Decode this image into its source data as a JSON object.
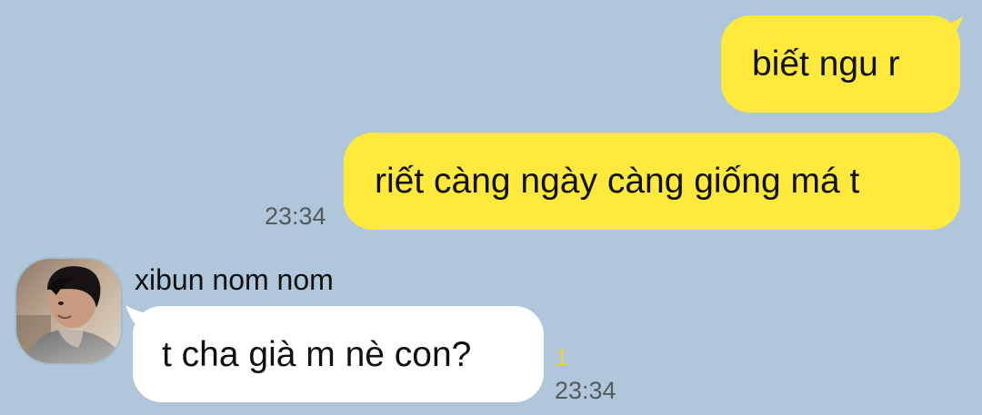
{
  "colors": {
    "chat_background": "#afc6db",
    "outgoing_bubble": "#fee93c",
    "incoming_bubble": "#ffffff",
    "timestamp": "#555a60",
    "unread_count": "#f2d12d"
  },
  "messages": {
    "outgoing": [
      {
        "text": "biết ngu r"
      },
      {
        "text": "riết càng ngày càng giống má t"
      }
    ],
    "outgoing_time": "23:34",
    "incoming": {
      "sender_name": "xibun nom nom",
      "avatar_icon": "profile-photo",
      "text": "t cha già m nè con?",
      "unread_count": "1",
      "time": "23:34"
    }
  }
}
